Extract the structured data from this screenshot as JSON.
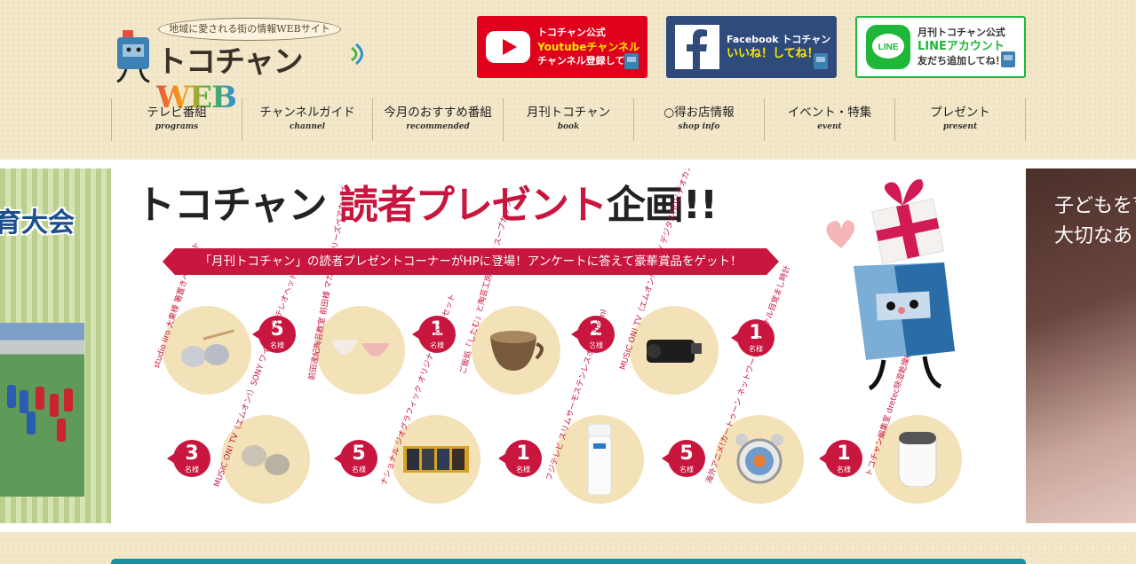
{
  "header": {
    "tagline": "地域に愛される街の情報WEBサイト",
    "logo_text": "トコチャン",
    "logo_web": "WEB"
  },
  "sns": {
    "youtube": {
      "line1": "トコチャン公式",
      "line2": "Youtubeチャンネル",
      "line3": "チャンネル登録してね！"
    },
    "facebook": {
      "line1": "Facebook トコチャン",
      "line2": "いいね！してね！"
    },
    "line": {
      "line1": "月刊トコチャン公式",
      "line2": "LINEアカウント",
      "line3": "友だち追加してね！",
      "icon_text": "LINE"
    }
  },
  "nav": [
    {
      "ja": "テレビ番組",
      "en": "programs"
    },
    {
      "ja": "チャンネルガイド",
      "en": "channel"
    },
    {
      "ja": "今月のおすすめ番組",
      "en": "recommended"
    },
    {
      "ja": "月刊トコチャン",
      "en": "book"
    },
    {
      "ja": "○得お店情報",
      "en": "shop info"
    },
    {
      "ja": "イベント・特集",
      "en": "event"
    },
    {
      "ja": "プレゼント",
      "en": "present"
    }
  ],
  "left_slide": {
    "title": "育大会"
  },
  "right_slide": {
    "line1": "子どもを育",
    "line2": "大切なあ"
  },
  "banner": {
    "title_part1": "トコチャン",
    "title_part2": "読者プレゼント",
    "title_part3": "企画!!",
    "ribbon": "「月刊トコチャン」の読者プレゼントコーナーがHPに登場！アンケートに答えて豪華賞品をゲット！",
    "prizes": [
      {
        "label": "studio iiro 大東様 箸置きペアセット",
        "count": "5",
        "unit": "名様"
      },
      {
        "label": "前田達紀陶芸教室 前田様 マカロンシリーズペアカップ",
        "count": "1",
        "unit": "名様"
      },
      {
        "label": "ご飯処「したむ」と陶芸工房 吉永様 スープカップ",
        "count": "2",
        "unit": "名様"
      },
      {
        "label": "MUSIC ON! TV（エムオン!）SONY デジタルHDビデオカメラレコーダー",
        "count": "1",
        "unit": "名様"
      },
      {
        "label": "MUSIC ON! TV（エムオン!）SONY ワイヤレスステレオヘッドセット",
        "count": "3",
        "unit": "名様"
      },
      {
        "label": "ナショナル ジオグラフィック オリジナルDVD4種セット",
        "count": "5",
        "unit": "名様"
      },
      {
        "label": "フジテレビ スリムサーモステンレスボトル300ml",
        "count": "1",
        "unit": "名様"
      },
      {
        "label": "海外アニメ!カートゥーン ネットワーク オリジナル目覚まし時計",
        "count": "5",
        "unit": "名様"
      },
      {
        "label": "トコチャン編集室 dretec除湿乾燥機",
        "count": "1",
        "unit": "名様"
      }
    ]
  },
  "colors": {
    "accent": "#c8163f",
    "teal": "#1591a1",
    "youtube": "#e0001b",
    "facebook": "#2f4b7c",
    "line": "#1fb73a"
  }
}
